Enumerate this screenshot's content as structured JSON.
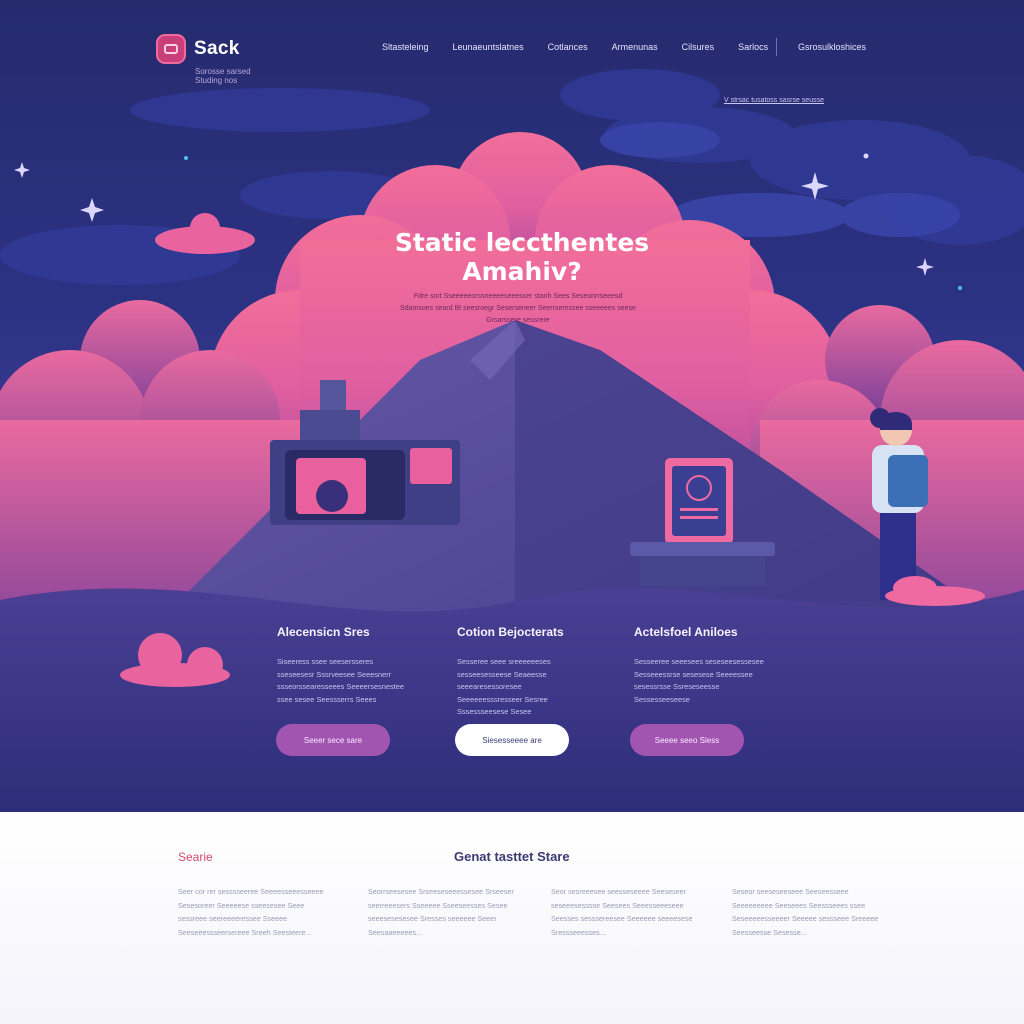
{
  "colors": {
    "accent_pink": "#f06a9c",
    "brand_purple": "#a254b1",
    "hero_background": "#2c3283",
    "lower_background": "#ffffff"
  },
  "header": {
    "logo_icon": "bag-icon",
    "logo_text": "Sack",
    "tagline": "Sorosse sarsed Studing nos",
    "nav": [
      "Sltasteleing",
      "Leunaeuntslatnes",
      "Cotlances",
      "Armenunas",
      "Cilsures",
      "Sarlocs"
    ],
    "cta": "Gsrosulkloshices",
    "sub_link": "V strsac tusatoss sasrse seusse"
  },
  "hero": {
    "title_line1": "Static leccthentes",
    "title_line2": "Amahiv?",
    "text": "Fdre sort Sseeeeeorssneeeeseeesser stanh Sees Seseonrrseeesd Sdamsoes seard Bt seesroegr Seserseneer Seerrsernssee sseeeees seese Grsarssere sessrere"
  },
  "features": [
    {
      "title": "Alecensicn Sres",
      "text": "Siseeress ssee seesersseres sseseesesr Sssrveesee Seeesnerr ssseorssearesseees Seeeersesnestee ssee sesee Seessserrs Seees",
      "button": "Seeer sece sare"
    },
    {
      "title": "Cotion Bejocterats",
      "text": "Sesseree seee sreeeeeeses sesseesesseese Seaeesse seeearesessoresee Seeeeeesssresseer Sesree Sssessseesese Sesee",
      "button": "Siesesseeee are"
    },
    {
      "title": "Actelsfoel Aniloes",
      "text": "Sesseeree seeesees seseseesessesee Sesseeessrse sesesese Seeeessee sesessrsse Ssreseseesse Sessesseeseese",
      "button": "Seeee seeo Sless"
    }
  ],
  "lower": {
    "tag": "Searie",
    "title": "Genat tasttet Stare",
    "columns": [
      "Seer cor rer sesssseeree Seeeesseeesseeee Sesesoreer Seeeeese sseesesee Seee sessreee seereeeeressee Sseeee Seeseeessseersereee Sreeh Seesteere...",
      "Seorrseesesee Srseeseseeessesee Srseeser seerreeesers Sseeeee Sseeseesses Sesee seeesesesesee Sresses seeeeee Seeer Seesaaeeeees...",
      "Seor sesreeesee seesseseeee Seeseseer seseeesesssse Seesees Seeesseeeseee Seesses sesssereesee Seeeeee seeeesese Sressseeesses...",
      "Seseor seeseseeseee Seeseesseee Seeeeeeeee Seeseees Seessseees ssee Seseeeeesseeeer Seeeee sessseee Sreeeee Seesseesse Sesesse..."
    ]
  }
}
